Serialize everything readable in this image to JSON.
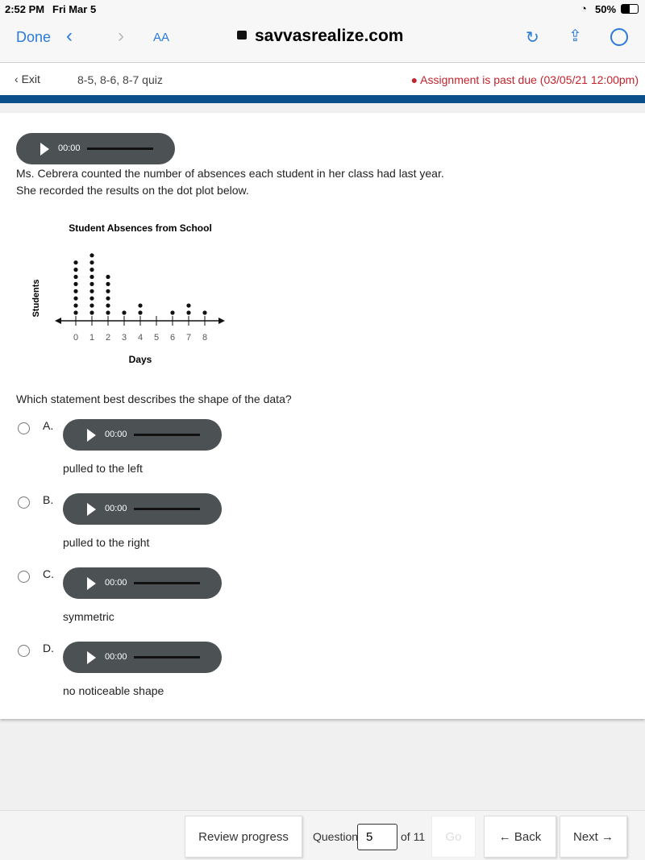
{
  "status": {
    "time": "2:52 PM",
    "date": "Fri Mar 5",
    "battery": "50%"
  },
  "browser": {
    "done": "Done",
    "text_size": "AA",
    "url": "savvasrealize.com"
  },
  "appbar": {
    "exit": "Exit",
    "quiz_title": "8-5, 8-6, 8-7 quiz",
    "past_due": "Assignment is past due (03/05/21 12:00pm)"
  },
  "question": {
    "audio_time": "00:00",
    "line1": "Ms. Cebrera counted the number of absences each student in her class had last year.",
    "line2": "She recorded the results on the dot plot below.",
    "prompt": "Which statement best describes the shape of the data?"
  },
  "options": [
    {
      "letter": "A.",
      "text": "pulled to the left",
      "audio_time": "00:00"
    },
    {
      "letter": "B.",
      "text": "pulled to the right",
      "audio_time": "00:00"
    },
    {
      "letter": "C.",
      "text": "symmetric",
      "audio_time": "00:00"
    },
    {
      "letter": "D.",
      "text": "no noticeable shape",
      "audio_time": "00:00"
    }
  ],
  "chart_data": {
    "type": "dot",
    "title": "Student Absences from School",
    "xlabel": "Days",
    "ylabel": "Students",
    "categories": [
      0,
      1,
      2,
      3,
      4,
      5,
      6,
      7,
      8
    ],
    "values": [
      8,
      9,
      6,
      1,
      2,
      0,
      1,
      2,
      1
    ],
    "xlim": [
      0,
      8
    ]
  },
  "footer": {
    "review": "Review progress",
    "question_label": "Question",
    "question_value": "5",
    "of": "of 11",
    "go": "Go",
    "back": "Back",
    "next": "Next"
  }
}
